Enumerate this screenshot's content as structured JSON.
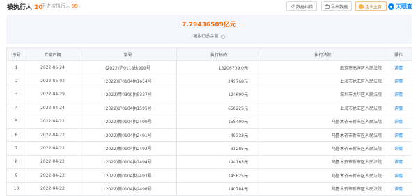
{
  "header": {
    "title": "被执行人",
    "count": "20",
    "history_label": "历史被执行人",
    "history_count": "89",
    "buttons": {
      "correction": "数据纠错",
      "export": "导出数据",
      "vip": "企业主页"
    },
    "brand": "天眼查"
  },
  "summary": {
    "amount": "7.79436509亿元",
    "label": "被执行总金额"
  },
  "table": {
    "columns": [
      "序号",
      "立案日期",
      "案号",
      "执行标的",
      "执行法院",
      "操作"
    ],
    "rows": [
      {
        "no": "1",
        "date": "2022-05-24",
        "case": "(2022)沪0118执999号",
        "amount": "13206709.0元",
        "court": "南京市高淳区人民法院",
        "op": "详情"
      },
      {
        "no": "2",
        "date": "2022-05-02",
        "case": "(2022)沪0104执1614号",
        "amount": "249768元",
        "court": "上海市徐汇区人民法院",
        "op": "详情"
      },
      {
        "no": "3",
        "date": "2022-04-29",
        "case": "(2022)粤0309执5337号",
        "amount": "124690元",
        "court": "深圳市龙华区人民法院",
        "op": "详情"
      },
      {
        "no": "4",
        "date": "2022-04-24",
        "case": "(2022)沪0104执1595号",
        "amount": "658225元",
        "court": "上海市徐汇区人民法院",
        "op": "详情"
      },
      {
        "no": "5",
        "date": "2022-04-22",
        "case": "(2022)新0104执2490号",
        "amount": "158400元",
        "court": "乌鲁木齐市新市区人民法院",
        "op": "详情"
      },
      {
        "no": "6",
        "date": "2022-04-22",
        "case": "(2022)新0104执2491号",
        "amount": "49333元",
        "court": "乌鲁木齐市新市区人民法院",
        "op": "详情"
      },
      {
        "no": "7",
        "date": "2022-04-22",
        "case": "(2022)新0104执2492号",
        "amount": "31285元",
        "court": "乌鲁木齐市新市区人民法院",
        "op": "详情"
      },
      {
        "no": "8",
        "date": "2022-04-22",
        "case": "(2022)新0104执2494号",
        "amount": "194163元",
        "court": "乌鲁木齐市新市区人民法院",
        "op": "详情"
      },
      {
        "no": "9",
        "date": "2022-04-22",
        "case": "(2022)新0104执2493号",
        "amount": "145625元",
        "court": "乌鲁木齐市新市区人民法院",
        "op": "详情"
      },
      {
        "no": "10",
        "date": "2022-04-22",
        "case": "(2022)新0104执2496号",
        "amount": "140784元",
        "court": "乌鲁木齐市新市区人民法院",
        "op": "详情"
      }
    ]
  }
}
